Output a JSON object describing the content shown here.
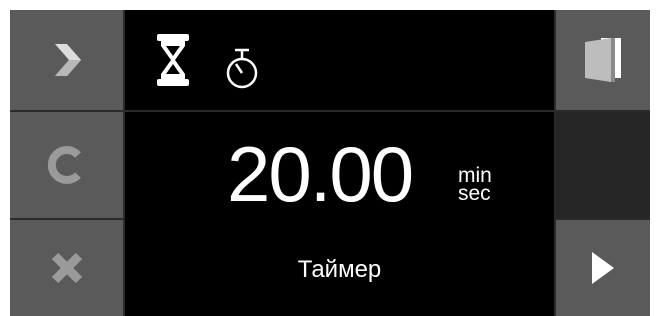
{
  "colors": {
    "panel_background": "#2b2b2b",
    "button_background": "#5a5a5a",
    "screen_background": "#000000",
    "icon_gray": "#9a9a9a",
    "icon_light": "#dcdcdc",
    "text": "#ffffff"
  },
  "left_buttons": [
    {
      "icon": "chevron-right-icon"
    },
    {
      "icon": "c-letter-icon"
    },
    {
      "icon": "x-letter-icon"
    }
  ],
  "right_buttons": [
    {
      "icon": "door-exit-icon"
    },
    {
      "icon": "play-icon"
    }
  ],
  "mode_tabs": [
    {
      "icon": "hourglass-icon",
      "selected": true
    },
    {
      "icon": "stopwatch-icon",
      "selected": false
    }
  ],
  "timer": {
    "value": "20.00",
    "unit_top": "min",
    "unit_bottom": "sec",
    "label": "Таймер"
  }
}
